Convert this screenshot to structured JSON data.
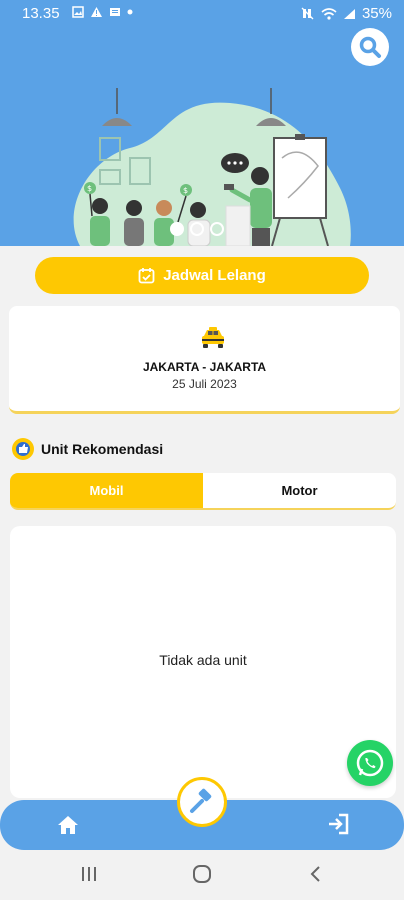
{
  "status": {
    "time": "13.35",
    "battery": "35%",
    "left_icons": [
      "image-icon",
      "alert-icon",
      "message-icon",
      "dot-icon"
    ],
    "right_icons": [
      "mute-icon",
      "wifi-icon",
      "signal-icon"
    ]
  },
  "header": {
    "search_icon": "search-icon",
    "carousel_dots": 3,
    "carousel_active": 1
  },
  "jadwal": {
    "label": "Jadwal Lelang",
    "icon": "calendar-icon"
  },
  "location": {
    "title": "JAKARTA - JAKARTA",
    "date": "25 Juli 2023",
    "icon": "taxi-icon"
  },
  "rekomendasi": {
    "title": "Unit Rekomendasi",
    "icon": "unit-rekomendasi-icon",
    "tabs": [
      {
        "label": "Mobil",
        "active": true
      },
      {
        "label": "Motor",
        "active": false
      }
    ],
    "empty_text": "Tidak ada unit"
  },
  "nav": {
    "home_icon": "home-icon",
    "center_icon": "auction-hammer-icon",
    "logout_icon": "logout-icon"
  },
  "colors": {
    "primary": "#5aa2e6",
    "accent": "#fec802",
    "whatsapp": "#25d366"
  }
}
